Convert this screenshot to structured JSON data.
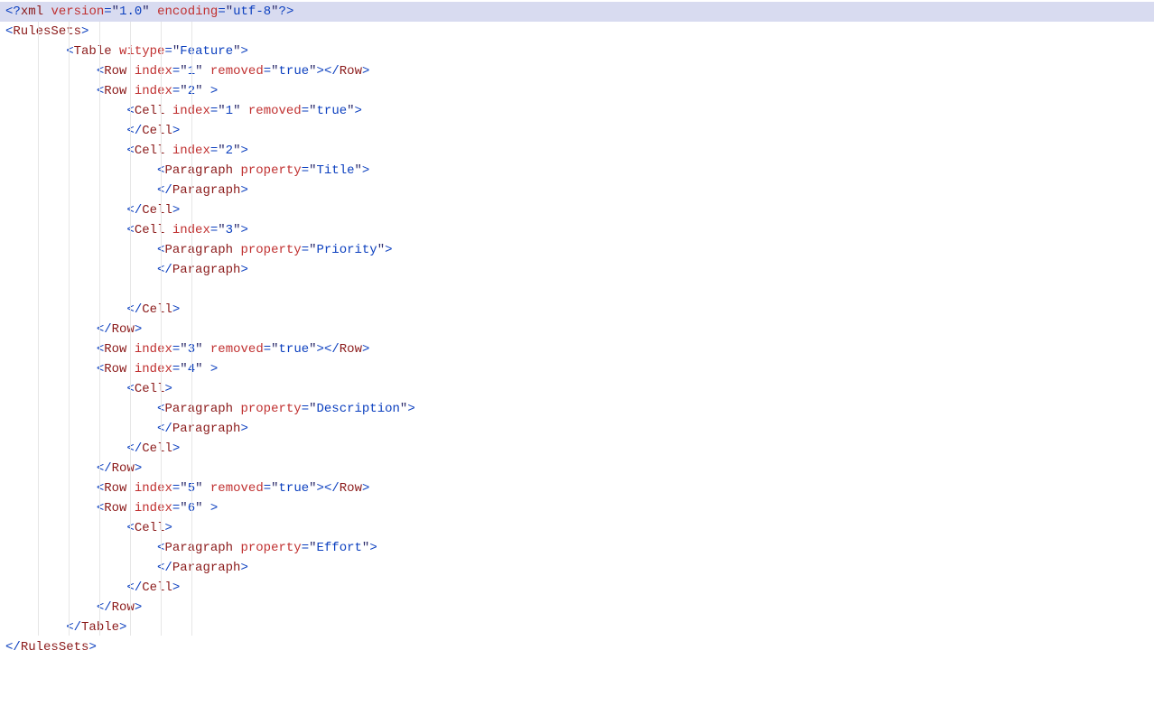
{
  "code": {
    "indent_unit": "    ",
    "lines": [
      {
        "highlight": true,
        "indent": 0,
        "tokens": [
          {
            "c": "pi",
            "t": "<?"
          },
          {
            "c": "name",
            "t": "xml"
          },
          {
            "c": "",
            "t": " "
          },
          {
            "c": "attr",
            "t": "version"
          },
          {
            "c": "op",
            "t": "="
          },
          {
            "c": "q",
            "t": "\""
          },
          {
            "c": "str",
            "t": "1.0"
          },
          {
            "c": "q",
            "t": "\""
          },
          {
            "c": "",
            "t": " "
          },
          {
            "c": "attr",
            "t": "encoding"
          },
          {
            "c": "op",
            "t": "="
          },
          {
            "c": "q",
            "t": "\""
          },
          {
            "c": "str",
            "t": "utf-8"
          },
          {
            "c": "q",
            "t": "\""
          },
          {
            "c": "pi",
            "t": "?>"
          }
        ]
      },
      {
        "indent": 0,
        "tokens": [
          {
            "c": "pi",
            "t": "<"
          },
          {
            "c": "name",
            "t": "RulesSets"
          },
          {
            "c": "pi",
            "t": ">"
          }
        ]
      },
      {
        "indent": 2,
        "tokens": [
          {
            "c": "pi",
            "t": "<"
          },
          {
            "c": "name",
            "t": "Table"
          },
          {
            "c": "",
            "t": " "
          },
          {
            "c": "attr",
            "t": "witype"
          },
          {
            "c": "op",
            "t": "="
          },
          {
            "c": "q",
            "t": "\""
          },
          {
            "c": "str",
            "t": "Feature"
          },
          {
            "c": "q",
            "t": "\""
          },
          {
            "c": "pi",
            "t": ">"
          }
        ]
      },
      {
        "indent": 3,
        "tokens": [
          {
            "c": "pi",
            "t": "<"
          },
          {
            "c": "name",
            "t": "Row"
          },
          {
            "c": "",
            "t": " "
          },
          {
            "c": "attr",
            "t": "index"
          },
          {
            "c": "op",
            "t": "="
          },
          {
            "c": "q",
            "t": "\""
          },
          {
            "c": "str",
            "t": "1"
          },
          {
            "c": "q",
            "t": "\""
          },
          {
            "c": "",
            "t": " "
          },
          {
            "c": "attr",
            "t": "removed"
          },
          {
            "c": "op",
            "t": "="
          },
          {
            "c": "q",
            "t": "\""
          },
          {
            "c": "str",
            "t": "true"
          },
          {
            "c": "q",
            "t": "\""
          },
          {
            "c": "pi",
            "t": ">"
          },
          {
            "c": "pi",
            "t": "</"
          },
          {
            "c": "name",
            "t": "Row"
          },
          {
            "c": "pi",
            "t": ">"
          }
        ]
      },
      {
        "indent": 3,
        "tokens": [
          {
            "c": "pi",
            "t": "<"
          },
          {
            "c": "name",
            "t": "Row"
          },
          {
            "c": "",
            "t": " "
          },
          {
            "c": "attr",
            "t": "index"
          },
          {
            "c": "op",
            "t": "="
          },
          {
            "c": "q",
            "t": "\""
          },
          {
            "c": "str",
            "t": "2"
          },
          {
            "c": "q",
            "t": "\""
          },
          {
            "c": "",
            "t": " "
          },
          {
            "c": "pi",
            "t": ">"
          }
        ]
      },
      {
        "indent": 4,
        "tokens": [
          {
            "c": "pi",
            "t": "<"
          },
          {
            "c": "name",
            "t": "Cell"
          },
          {
            "c": "",
            "t": " "
          },
          {
            "c": "attr",
            "t": "index"
          },
          {
            "c": "op",
            "t": "="
          },
          {
            "c": "q",
            "t": "\""
          },
          {
            "c": "str",
            "t": "1"
          },
          {
            "c": "q",
            "t": "\""
          },
          {
            "c": "",
            "t": " "
          },
          {
            "c": "attr",
            "t": "removed"
          },
          {
            "c": "op",
            "t": "="
          },
          {
            "c": "q",
            "t": "\""
          },
          {
            "c": "str",
            "t": "true"
          },
          {
            "c": "q",
            "t": "\""
          },
          {
            "c": "pi",
            "t": ">"
          }
        ]
      },
      {
        "indent": 4,
        "tokens": [
          {
            "c": "pi",
            "t": "</"
          },
          {
            "c": "name",
            "t": "Cell"
          },
          {
            "c": "pi",
            "t": ">"
          }
        ]
      },
      {
        "indent": 4,
        "tokens": [
          {
            "c": "pi",
            "t": "<"
          },
          {
            "c": "name",
            "t": "Cell"
          },
          {
            "c": "",
            "t": " "
          },
          {
            "c": "attr",
            "t": "index"
          },
          {
            "c": "op",
            "t": "="
          },
          {
            "c": "q",
            "t": "\""
          },
          {
            "c": "str",
            "t": "2"
          },
          {
            "c": "q",
            "t": "\""
          },
          {
            "c": "pi",
            "t": ">"
          }
        ]
      },
      {
        "indent": 5,
        "tokens": [
          {
            "c": "pi",
            "t": "<"
          },
          {
            "c": "name",
            "t": "Paragraph"
          },
          {
            "c": "",
            "t": " "
          },
          {
            "c": "attr",
            "t": "property"
          },
          {
            "c": "op",
            "t": "="
          },
          {
            "c": "q",
            "t": "\""
          },
          {
            "c": "str",
            "t": "Title"
          },
          {
            "c": "q",
            "t": "\""
          },
          {
            "c": "pi",
            "t": ">"
          }
        ]
      },
      {
        "indent": 5,
        "tokens": [
          {
            "c": "pi",
            "t": "</"
          },
          {
            "c": "name",
            "t": "Paragraph"
          },
          {
            "c": "pi",
            "t": ">"
          }
        ]
      },
      {
        "indent": 4,
        "tokens": [
          {
            "c": "pi",
            "t": "</"
          },
          {
            "c": "name",
            "t": "Cell"
          },
          {
            "c": "pi",
            "t": ">"
          }
        ]
      },
      {
        "indent": 4,
        "tokens": [
          {
            "c": "pi",
            "t": "<"
          },
          {
            "c": "name",
            "t": "Cell"
          },
          {
            "c": "",
            "t": " "
          },
          {
            "c": "attr",
            "t": "index"
          },
          {
            "c": "op",
            "t": "="
          },
          {
            "c": "q",
            "t": "\""
          },
          {
            "c": "str",
            "t": "3"
          },
          {
            "c": "q",
            "t": "\""
          },
          {
            "c": "pi",
            "t": ">"
          }
        ]
      },
      {
        "indent": 5,
        "tokens": [
          {
            "c": "pi",
            "t": "<"
          },
          {
            "c": "name",
            "t": "Paragraph"
          },
          {
            "c": "",
            "t": " "
          },
          {
            "c": "attr",
            "t": "property"
          },
          {
            "c": "op",
            "t": "="
          },
          {
            "c": "q",
            "t": "\""
          },
          {
            "c": "str",
            "t": "Priority"
          },
          {
            "c": "q",
            "t": "\""
          },
          {
            "c": "pi",
            "t": ">"
          }
        ]
      },
      {
        "indent": 5,
        "tokens": [
          {
            "c": "pi",
            "t": "</"
          },
          {
            "c": "name",
            "t": "Paragraph"
          },
          {
            "c": "pi",
            "t": ">"
          }
        ]
      },
      {
        "indent": 5,
        "tokens": []
      },
      {
        "indent": 4,
        "tokens": [
          {
            "c": "pi",
            "t": "</"
          },
          {
            "c": "name",
            "t": "Cell"
          },
          {
            "c": "pi",
            "t": ">"
          }
        ]
      },
      {
        "indent": 3,
        "tokens": [
          {
            "c": "pi",
            "t": "</"
          },
          {
            "c": "name",
            "t": "Row"
          },
          {
            "c": "pi",
            "t": ">"
          }
        ]
      },
      {
        "indent": 3,
        "tokens": [
          {
            "c": "pi",
            "t": "<"
          },
          {
            "c": "name",
            "t": "Row"
          },
          {
            "c": "",
            "t": " "
          },
          {
            "c": "attr",
            "t": "index"
          },
          {
            "c": "op",
            "t": "="
          },
          {
            "c": "q",
            "t": "\""
          },
          {
            "c": "str",
            "t": "3"
          },
          {
            "c": "q",
            "t": "\""
          },
          {
            "c": "",
            "t": " "
          },
          {
            "c": "attr",
            "t": "removed"
          },
          {
            "c": "op",
            "t": "="
          },
          {
            "c": "q",
            "t": "\""
          },
          {
            "c": "str",
            "t": "true"
          },
          {
            "c": "q",
            "t": "\""
          },
          {
            "c": "pi",
            "t": ">"
          },
          {
            "c": "pi",
            "t": "</"
          },
          {
            "c": "name",
            "t": "Row"
          },
          {
            "c": "pi",
            "t": ">"
          }
        ]
      },
      {
        "indent": 3,
        "tokens": [
          {
            "c": "pi",
            "t": "<"
          },
          {
            "c": "name",
            "t": "Row"
          },
          {
            "c": "",
            "t": " "
          },
          {
            "c": "attr",
            "t": "index"
          },
          {
            "c": "op",
            "t": "="
          },
          {
            "c": "q",
            "t": "\""
          },
          {
            "c": "str",
            "t": "4"
          },
          {
            "c": "q",
            "t": "\""
          },
          {
            "c": "",
            "t": " "
          },
          {
            "c": "pi",
            "t": ">"
          }
        ]
      },
      {
        "indent": 4,
        "tokens": [
          {
            "c": "pi",
            "t": "<"
          },
          {
            "c": "name",
            "t": "Cell"
          },
          {
            "c": "pi",
            "t": ">"
          }
        ]
      },
      {
        "indent": 5,
        "tokens": [
          {
            "c": "pi",
            "t": "<"
          },
          {
            "c": "name",
            "t": "Paragraph"
          },
          {
            "c": "",
            "t": " "
          },
          {
            "c": "attr",
            "t": "property"
          },
          {
            "c": "op",
            "t": "="
          },
          {
            "c": "q",
            "t": "\""
          },
          {
            "c": "str",
            "t": "Description"
          },
          {
            "c": "q",
            "t": "\""
          },
          {
            "c": "pi",
            "t": ">"
          }
        ]
      },
      {
        "indent": 5,
        "tokens": [
          {
            "c": "pi",
            "t": "</"
          },
          {
            "c": "name",
            "t": "Paragraph"
          },
          {
            "c": "pi",
            "t": ">"
          }
        ]
      },
      {
        "indent": 4,
        "tokens": [
          {
            "c": "pi",
            "t": "</"
          },
          {
            "c": "name",
            "t": "Cell"
          },
          {
            "c": "pi",
            "t": ">"
          }
        ]
      },
      {
        "indent": 3,
        "tokens": [
          {
            "c": "pi",
            "t": "</"
          },
          {
            "c": "name",
            "t": "Row"
          },
          {
            "c": "pi",
            "t": ">"
          }
        ]
      },
      {
        "indent": 3,
        "tokens": [
          {
            "c": "pi",
            "t": "<"
          },
          {
            "c": "name",
            "t": "Row"
          },
          {
            "c": "",
            "t": " "
          },
          {
            "c": "attr",
            "t": "index"
          },
          {
            "c": "op",
            "t": "="
          },
          {
            "c": "q",
            "t": "\""
          },
          {
            "c": "str",
            "t": "5"
          },
          {
            "c": "q",
            "t": "\""
          },
          {
            "c": "",
            "t": " "
          },
          {
            "c": "attr",
            "t": "removed"
          },
          {
            "c": "op",
            "t": "="
          },
          {
            "c": "q",
            "t": "\""
          },
          {
            "c": "str",
            "t": "true"
          },
          {
            "c": "q",
            "t": "\""
          },
          {
            "c": "pi",
            "t": ">"
          },
          {
            "c": "pi",
            "t": "</"
          },
          {
            "c": "name",
            "t": "Row"
          },
          {
            "c": "pi",
            "t": ">"
          }
        ]
      },
      {
        "indent": 3,
        "tokens": [
          {
            "c": "pi",
            "t": "<"
          },
          {
            "c": "name",
            "t": "Row"
          },
          {
            "c": "",
            "t": " "
          },
          {
            "c": "attr",
            "t": "index"
          },
          {
            "c": "op",
            "t": "="
          },
          {
            "c": "q",
            "t": "\""
          },
          {
            "c": "str",
            "t": "6"
          },
          {
            "c": "q",
            "t": "\""
          },
          {
            "c": "",
            "t": " "
          },
          {
            "c": "pi",
            "t": ">"
          }
        ]
      },
      {
        "indent": 4,
        "tokens": [
          {
            "c": "pi",
            "t": "<"
          },
          {
            "c": "name",
            "t": "Cell"
          },
          {
            "c": "pi",
            "t": ">"
          }
        ]
      },
      {
        "indent": 5,
        "tokens": [
          {
            "c": "pi",
            "t": "<"
          },
          {
            "c": "name",
            "t": "Paragraph"
          },
          {
            "c": "",
            "t": " "
          },
          {
            "c": "attr",
            "t": "property"
          },
          {
            "c": "op",
            "t": "="
          },
          {
            "c": "q",
            "t": "\""
          },
          {
            "c": "str",
            "t": "Effort"
          },
          {
            "c": "q",
            "t": "\""
          },
          {
            "c": "pi",
            "t": ">"
          }
        ]
      },
      {
        "indent": 5,
        "tokens": [
          {
            "c": "pi",
            "t": "</"
          },
          {
            "c": "name",
            "t": "Paragraph"
          },
          {
            "c": "pi",
            "t": ">"
          }
        ]
      },
      {
        "indent": 4,
        "tokens": [
          {
            "c": "pi",
            "t": "</"
          },
          {
            "c": "name",
            "t": "Cell"
          },
          {
            "c": "pi",
            "t": ">"
          }
        ]
      },
      {
        "indent": 3,
        "tokens": [
          {
            "c": "pi",
            "t": "</"
          },
          {
            "c": "name",
            "t": "Row"
          },
          {
            "c": "pi",
            "t": ">"
          }
        ]
      },
      {
        "indent": 2,
        "tokens": [
          {
            "c": "pi",
            "t": "</"
          },
          {
            "c": "name",
            "t": "Table"
          },
          {
            "c": "pi",
            "t": ">"
          }
        ]
      },
      {
        "indent": 0,
        "tokens": [
          {
            "c": "pi",
            "t": "</"
          },
          {
            "c": "name",
            "t": "RulesSets"
          },
          {
            "c": "pi",
            "t": ">"
          }
        ]
      }
    ]
  }
}
